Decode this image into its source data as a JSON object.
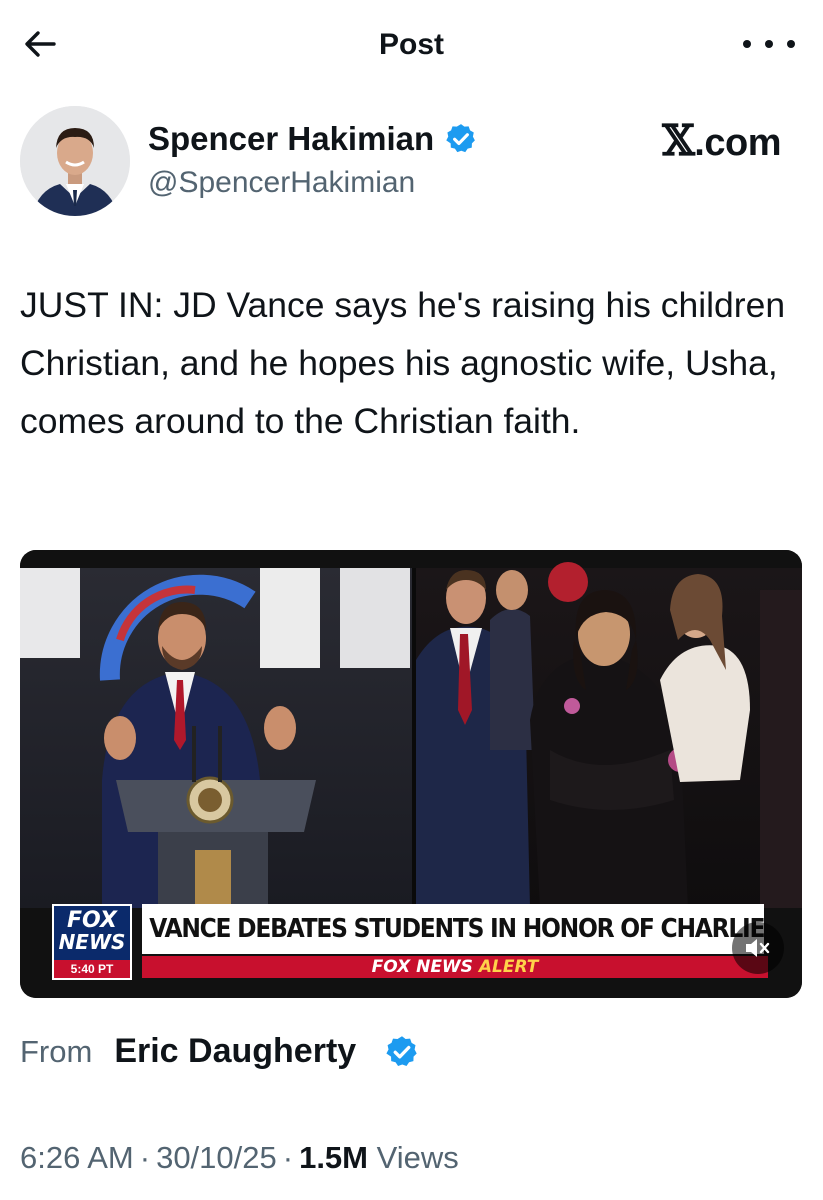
{
  "header": {
    "title": "Post"
  },
  "author": {
    "name": "Spencer Hakimian",
    "handle": "@SpencerHakimian",
    "verified": true
  },
  "source": {
    "logo_mark": "𝕏",
    "logo_text": ".com"
  },
  "tweet": {
    "text": "JUST IN: JD Vance says he's raising his children Christian, and he hopes his agnostic wife, Usha, comes around to the Christian faith."
  },
  "media": {
    "network_line1": "FOX",
    "network_line2": "NEWS",
    "broadcast_time": "5:40 PT",
    "headline": "VANCE DEBATES STUDENTS IN HONOR OF CHARLIE",
    "alert_prefix": "FOX NEWS",
    "alert_word": "ALERT"
  },
  "attribution": {
    "from_label": "From",
    "from_name": "Eric Daugherty",
    "verified": true
  },
  "meta": {
    "time": "6:26 AM",
    "date": "30/10/25",
    "views_count": "1.5M",
    "views_label": "Views",
    "separator": "·"
  },
  "colors": {
    "verified_blue": "#1d9bf0",
    "text_primary": "#0f1419",
    "text_secondary": "#536471",
    "fox_red": "#c8102e",
    "fox_blue": "#0b2a6b"
  }
}
